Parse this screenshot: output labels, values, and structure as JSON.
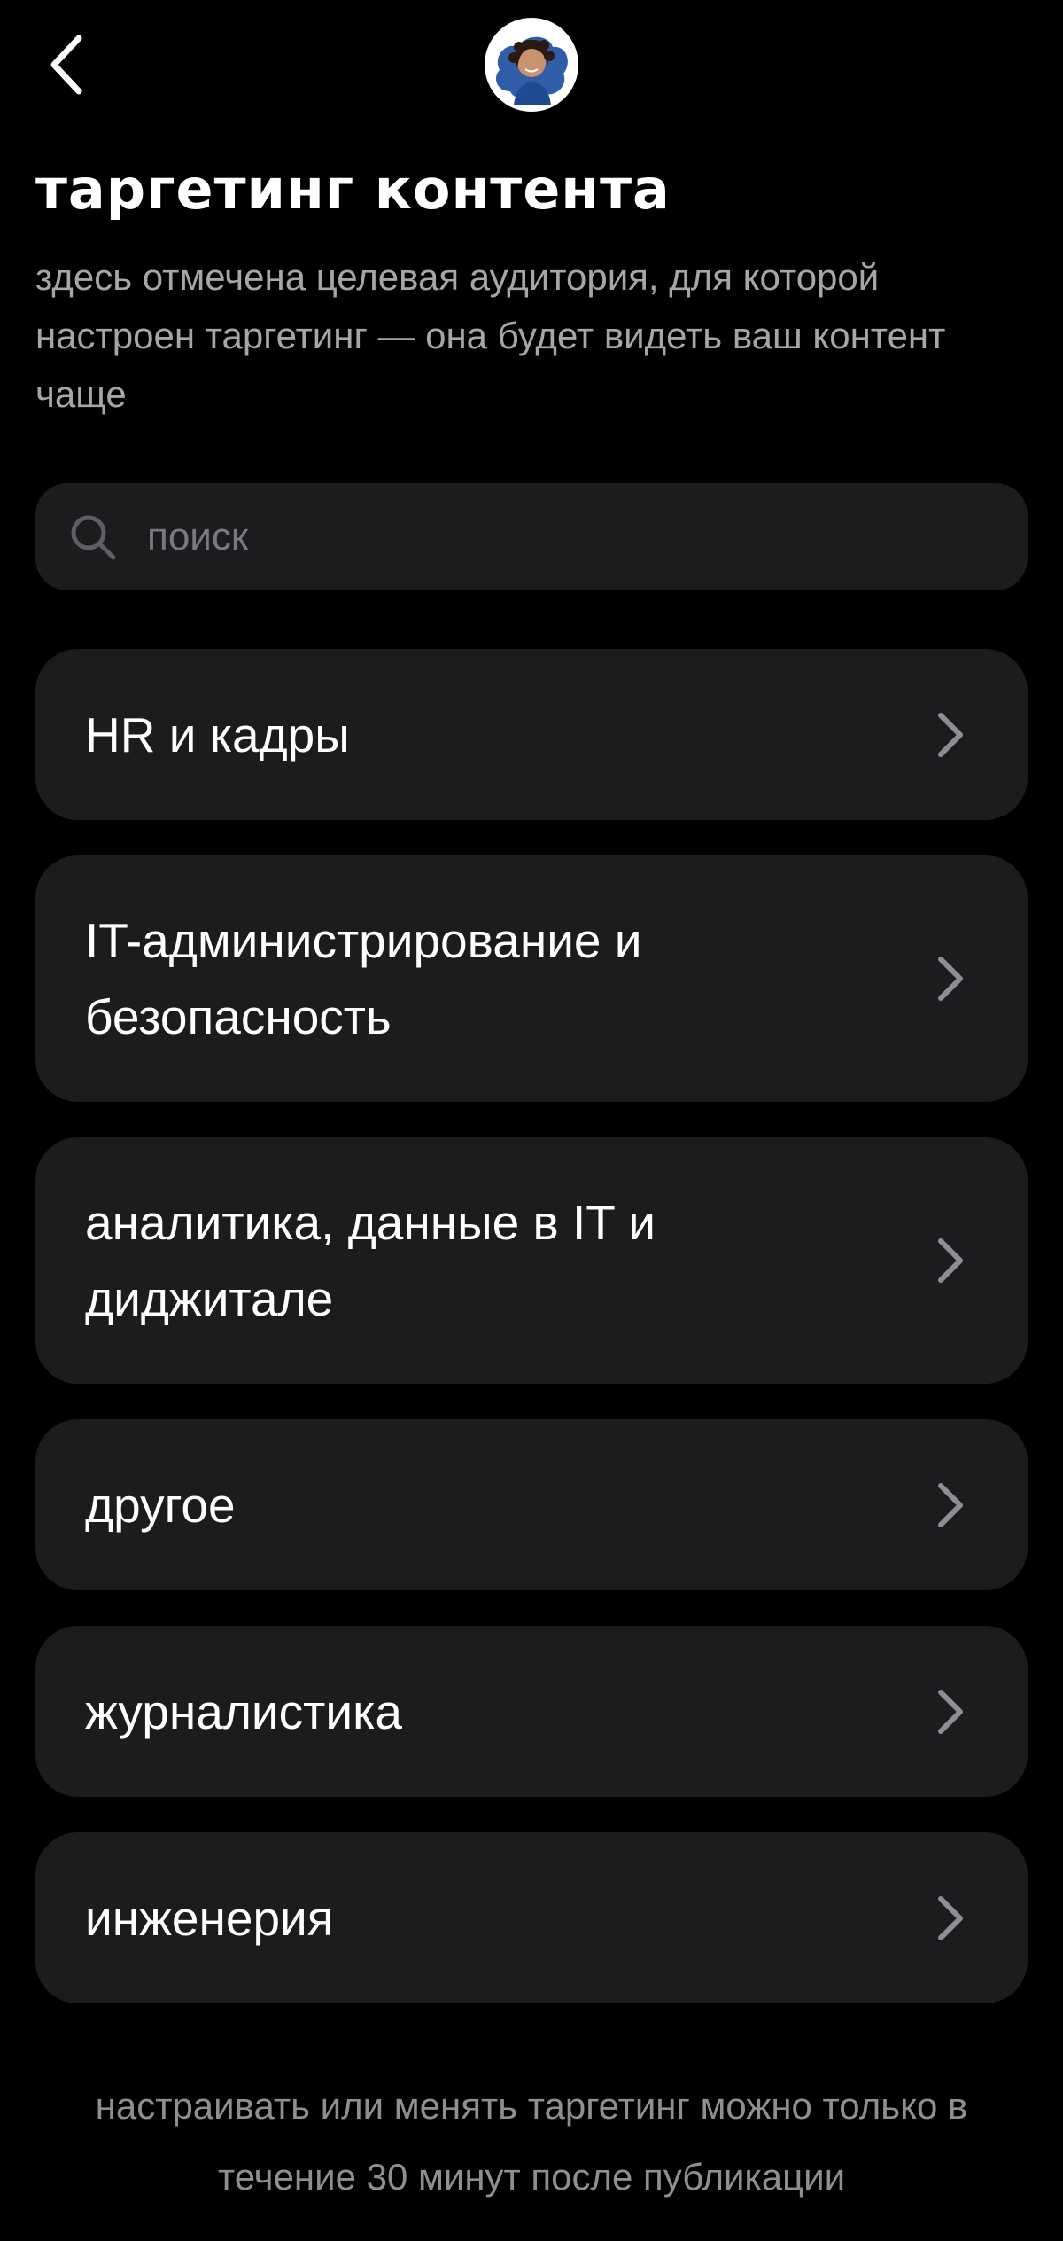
{
  "header": {
    "back_icon": "chevron-left-icon",
    "avatar_icon": "user-avatar"
  },
  "page": {
    "title": "таргетинг контента",
    "subtitle": "здесь отмечена целевая аудитория, для которой настроен таргетинг — она будет видеть ваш контент чаще"
  },
  "search": {
    "placeholder": "поиск",
    "value": "",
    "icon": "search-icon"
  },
  "categories": [
    {
      "label": "HR и кадры",
      "icon": "chevron-right-icon"
    },
    {
      "label": "IT-администрирование и безопасность",
      "icon": "chevron-right-icon"
    },
    {
      "label": "аналитика, данные в IT и диджитале",
      "icon": "chevron-right-icon"
    },
    {
      "label": "другое",
      "icon": "chevron-right-icon"
    },
    {
      "label": "журналистика",
      "icon": "chevron-right-icon"
    },
    {
      "label": "инженерия",
      "icon": "chevron-right-icon"
    }
  ],
  "footer": {
    "note": "настраивать или менять таргетинг можно только в течение 30 минут после публикации"
  },
  "colors": {
    "background": "#000000",
    "card": "#1c1c1e",
    "text_primary": "#ffffff",
    "text_secondary": "#a6a6a6",
    "placeholder": "#7a7a7e",
    "chevron": "#8e8e93"
  }
}
